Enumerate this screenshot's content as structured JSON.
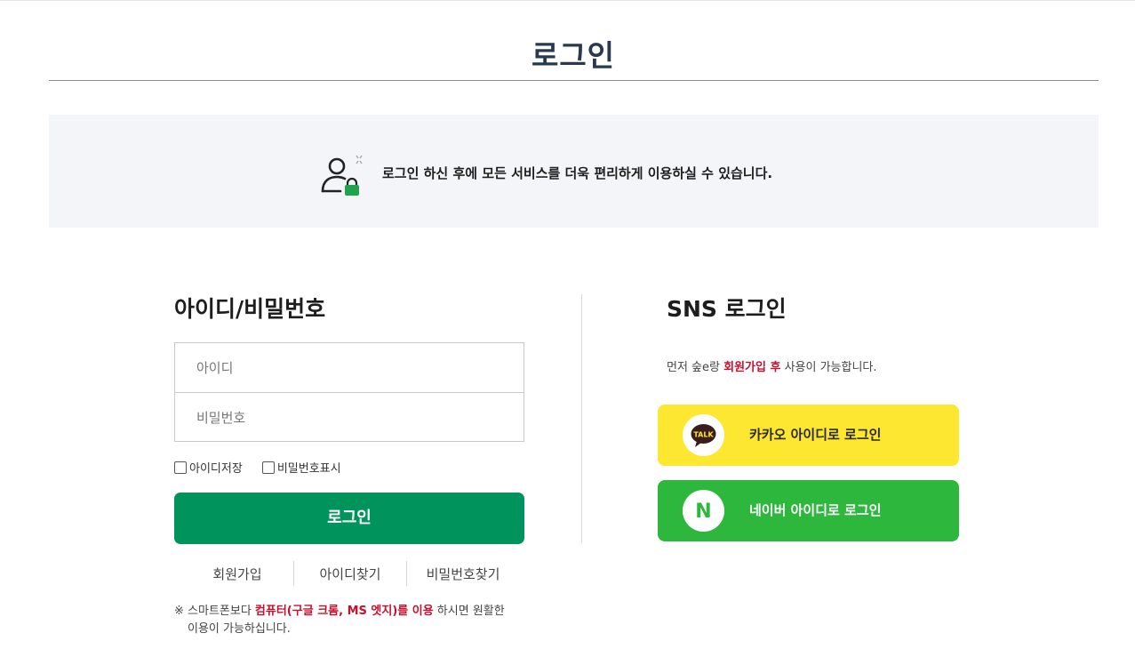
{
  "page": {
    "title": "로그인"
  },
  "notice": {
    "text": "로그인 하신 후에 모든 서비스를 더욱 편리하게 이용하실 수 있습니다.",
    "icon": "user-lock-icon"
  },
  "login_form": {
    "section_title": "아이디/비밀번호",
    "id_placeholder": "아이디",
    "password_placeholder": "비밀번호",
    "save_id_label": "아이디저장",
    "show_password_label": "비밀번호표시",
    "login_button": "로그인",
    "links": [
      "회원가입",
      "아이디찾기",
      "비밀번호찾기"
    ],
    "footnote": {
      "prefix": "※ 스마트폰보다 ",
      "highlight": "컴퓨터(구글 크롬, MS 엣지)를 이용",
      "suffix": " 하시면 원활한",
      "line2": "이용이 가능하십니다."
    },
    "accent_color": "#00935b"
  },
  "sns": {
    "section_title": "SNS 로그인",
    "desc_prefix": "먼저 숲e랑 ",
    "desc_highlight": "회원가입 후",
    "desc_suffix": " 사용이 가능합니다.",
    "kakao": {
      "label": "카카오 아이디로 로그인",
      "icon_text": "TALK",
      "color": "#fde731"
    },
    "naver": {
      "label": "네이버 아이디로 로그인",
      "icon_text": "N",
      "color": "#2db83d"
    }
  }
}
